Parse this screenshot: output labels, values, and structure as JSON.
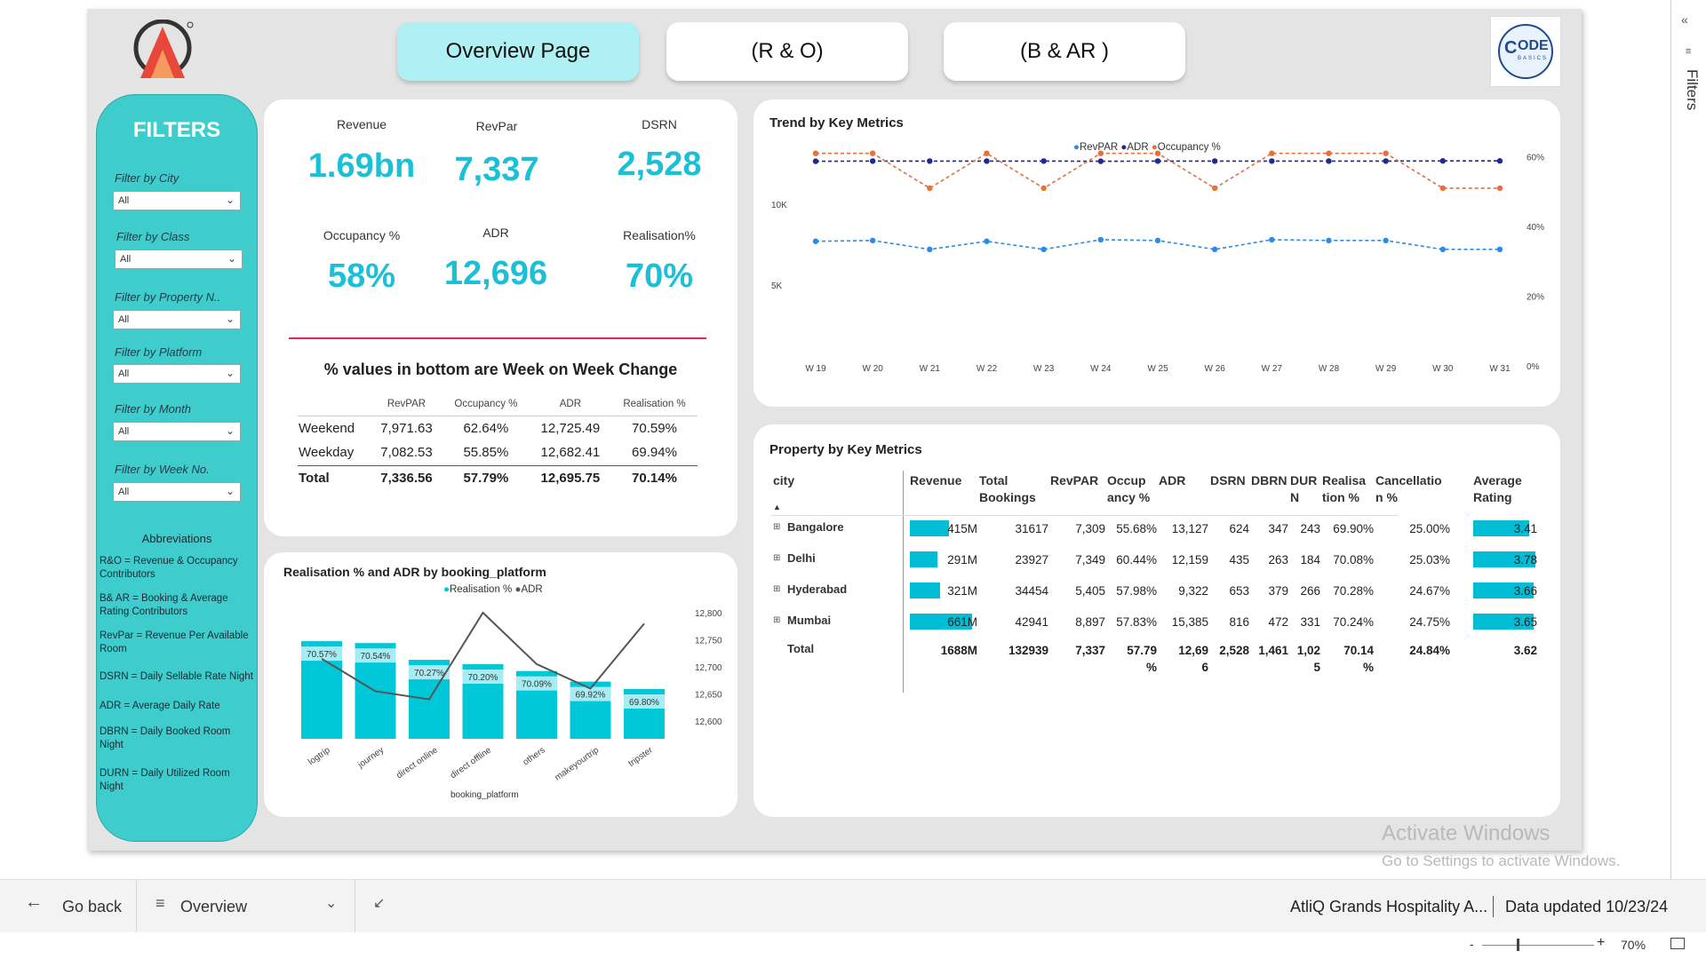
{
  "nav": {
    "overview": "Overview Page",
    "ro": "(R & O)",
    "bar": "(B & AR )",
    "logo_text": "ODE",
    "logo_sub": "BASICS"
  },
  "filters": {
    "title": "FILTERS",
    "items": [
      {
        "label": "Filter by City",
        "value": "All"
      },
      {
        "label": "Filter by Class",
        "value": "All"
      },
      {
        "label": "Filter by Property N..",
        "value": "All"
      },
      {
        "label": "Filter by Platform",
        "value": "All"
      },
      {
        "label": "Filter by Month",
        "value": "All"
      },
      {
        "label": "Filter by Week No.",
        "value": "All"
      }
    ],
    "abbr_title": "Abbreviations",
    "abbreviations": [
      "R&O = Revenue & Occupancy Contributors",
      "B& AR = Booking & Average Rating Contributors",
      "RevPar = Revenue Per Available Room",
      "DSRN = Daily Sellable Rate Night",
      "ADR = Average Daily Rate",
      "DBRN = Daily Booked Room Night",
      "DURN = Daily Utilized Room Night"
    ]
  },
  "kpis": [
    {
      "label": "Revenue",
      "value": "1.69bn"
    },
    {
      "label": "RevPar",
      "value": "7,337"
    },
    {
      "label": "DSRN",
      "value": "2,528"
    },
    {
      "label": "Occupancy %",
      "value": "58%"
    },
    {
      "label": "ADR",
      "value": "12,696"
    },
    {
      "label": "Realisation%",
      "value": "70%"
    }
  ],
  "wow": {
    "title": "% values in bottom are Week on Week Change",
    "headers": [
      "",
      "RevPAR",
      "Occupancy %",
      "ADR",
      "Realisation %"
    ],
    "rows": [
      [
        "Weekend",
        "7,971.63",
        "62.64%",
        "12,725.49",
        "70.59%"
      ],
      [
        "Weekday",
        "7,082.53",
        "55.85%",
        "12,682.41",
        "69.94%"
      ]
    ],
    "total": [
      "Total",
      "7,336.56",
      "57.79%",
      "12,695.75",
      "70.14%"
    ]
  },
  "trend": {
    "title": "Trend by Key Metrics",
    "legend": [
      "RevPAR",
      "ADR",
      "Occupancy %"
    ],
    "colors": {
      "revpar": "#2b8be6",
      "adr": "#1f2a8f",
      "occ": "#e8703a"
    }
  },
  "platform": {
    "title": "Realisation % and ADR by booking_platform",
    "legend": [
      "Realisation %",
      "ADR"
    ],
    "xlabel": "booking_platform",
    "colors": {
      "bar": "#00c8d9",
      "line": "#555555"
    }
  },
  "chart_data": [
    {
      "type": "line",
      "title": "Trend by Key Metrics",
      "x": [
        "W 19",
        "W 20",
        "W 21",
        "W 22",
        "W 23",
        "W 24",
        "W 25",
        "W 26",
        "W 27",
        "W 28",
        "W 29",
        "W 30",
        "W 31"
      ],
      "y_left_ticks": [
        "5K",
        "10K"
      ],
      "y_right_ticks": [
        "0%",
        "20%",
        "40%",
        "60%"
      ],
      "left_range": [
        0,
        14000
      ],
      "right_range": [
        0,
        0.65
      ],
      "series": [
        {
          "name": "RevPAR",
          "axis": "left",
          "values": [
            7700,
            7750,
            7200,
            7700,
            7200,
            7800,
            7750,
            7200,
            7800,
            7750,
            7750,
            7200,
            7200
          ]
        },
        {
          "name": "ADR",
          "axis": "left",
          "values": [
            12650,
            12660,
            12660,
            12660,
            12660,
            12650,
            12660,
            12660,
            12660,
            12660,
            12660,
            12670,
            12670
          ]
        },
        {
          "name": "Occupancy %",
          "axis": "right",
          "values": [
            0.61,
            0.61,
            0.51,
            0.61,
            0.51,
            0.61,
            0.61,
            0.51,
            0.61,
            0.61,
            0.61,
            0.51,
            0.51
          ]
        }
      ],
      "grid": false,
      "legend": "top-center"
    },
    {
      "type": "bar",
      "title": "Realisation % and ADR by booking_platform",
      "categories": [
        "logtrip",
        "journey",
        "direct online",
        "direct offline",
        "others",
        "makeyourtrip",
        "tripster"
      ],
      "series": [
        {
          "name": "Realisation %",
          "values": [
            70.57,
            70.54,
            70.27,
            70.2,
            70.09,
            69.92,
            69.8
          ],
          "labels": [
            "70.57%",
            "70.54%",
            "70.27%",
            "70.20%",
            "70.09%",
            "69.92%",
            "69.80%"
          ]
        },
        {
          "name": "ADR",
          "axis": "right",
          "values": [
            12715,
            12655,
            12640,
            12800,
            12705,
            12660,
            12780
          ]
        }
      ],
      "y_right_ticks": [
        "12,600",
        "12,650",
        "12,700",
        "12,750",
        "12,800"
      ],
      "right_range": [
        12600,
        12800
      ],
      "xlabel": "booking_platform",
      "legend": "top-center"
    },
    {
      "type": "table",
      "title": "Property by Key Metrics",
      "headers": [
        "city",
        "Revenue",
        "Total Bookings",
        "RevPAR",
        "Occupancy %",
        "ADR",
        "DSRN",
        "DBRN",
        "DURN",
        "Realisation %",
        "Cancellation %",
        "Average Rating"
      ],
      "header_lines": [
        [
          "city"
        ],
        [
          "Revenue"
        ],
        [
          "Total",
          "Bookings"
        ],
        [
          "RevPAR"
        ],
        [
          "Occup",
          "ancy %"
        ],
        [
          "ADR"
        ],
        [
          "DSRN"
        ],
        [
          "DBRN"
        ],
        [
          "DUR",
          "N"
        ],
        [
          "Realisa",
          "tion %"
        ],
        [
          "Cancellatio",
          "n %"
        ],
        [
          "Average",
          "Rating"
        ]
      ],
      "rows": [
        {
          "city": "Bangalore",
          "revenue": "415M",
          "rev_num": 415,
          "bookings": "31617",
          "revpar": "7,309",
          "occ": "55.68%",
          "adr": "13,127",
          "dsrn": "624",
          "dbrn": "347",
          "durn": "243",
          "real": "69.90%",
          "canc": "25.00%",
          "rating": "3.41",
          "rating_num": 3.41
        },
        {
          "city": "Delhi",
          "revenue": "291M",
          "rev_num": 291,
          "bookings": "23927",
          "revpar": "7,349",
          "occ": "60.44%",
          "adr": "12,159",
          "dsrn": "435",
          "dbrn": "263",
          "durn": "184",
          "real": "70.08%",
          "canc": "25.03%",
          "rating": "3.78",
          "rating_num": 3.78
        },
        {
          "city": "Hyderabad",
          "revenue": "321M",
          "rev_num": 321,
          "bookings": "34454",
          "revpar": "5,405",
          "occ": "57.98%",
          "adr": "9,322",
          "dsrn": "653",
          "dbrn": "379",
          "durn": "266",
          "real": "70.28%",
          "canc": "24.67%",
          "rating": "3.66",
          "rating_num": 3.66
        },
        {
          "city": "Mumbai",
          "revenue": "661M",
          "rev_num": 661,
          "bookings": "42941",
          "revpar": "8,897",
          "occ": "57.83%",
          "adr": "15,385",
          "dsrn": "816",
          "dbrn": "472",
          "durn": "331",
          "real": "70.24%",
          "canc": "24.75%",
          "rating": "3.65",
          "rating_num": 3.65
        }
      ],
      "total": {
        "city": "Total",
        "revenue": "1688M",
        "bookings": "132939",
        "revpar": "7,337",
        "occ": [
          "57.79",
          "%"
        ],
        "adr": [
          "12,69",
          "6"
        ],
        "dsrn": "2,528",
        "dbrn": "1,461",
        "durn": [
          "1,02",
          "5"
        ],
        "real": [
          "70.14",
          "%"
        ],
        "canc": "24.84%",
        "rating": "3.62"
      }
    }
  ],
  "watermark": {
    "line1": "Activate Windows",
    "line2": "Go to Settings to activate Windows."
  },
  "bottom": {
    "back": "Go back",
    "page": "Overview",
    "report": "AtliQ Grands Hospitality A...",
    "updated": "Data updated 10/23/24",
    "zoom": "70%",
    "side": "Filters"
  }
}
